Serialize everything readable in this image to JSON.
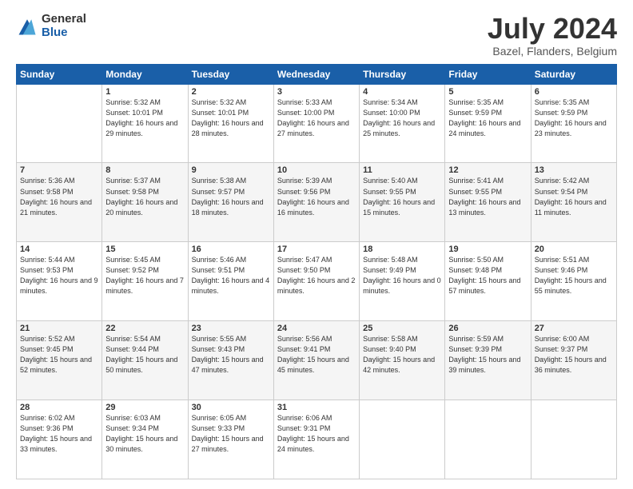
{
  "logo": {
    "general": "General",
    "blue": "Blue"
  },
  "header": {
    "month_year": "July 2024",
    "location": "Bazel, Flanders, Belgium"
  },
  "days_of_week": [
    "Sunday",
    "Monday",
    "Tuesday",
    "Wednesday",
    "Thursday",
    "Friday",
    "Saturday"
  ],
  "weeks": [
    [
      {
        "day": "",
        "sunrise": "",
        "sunset": "",
        "daylight": ""
      },
      {
        "day": "1",
        "sunrise": "Sunrise: 5:32 AM",
        "sunset": "Sunset: 10:01 PM",
        "daylight": "Daylight: 16 hours and 29 minutes."
      },
      {
        "day": "2",
        "sunrise": "Sunrise: 5:32 AM",
        "sunset": "Sunset: 10:01 PM",
        "daylight": "Daylight: 16 hours and 28 minutes."
      },
      {
        "day": "3",
        "sunrise": "Sunrise: 5:33 AM",
        "sunset": "Sunset: 10:00 PM",
        "daylight": "Daylight: 16 hours and 27 minutes."
      },
      {
        "day": "4",
        "sunrise": "Sunrise: 5:34 AM",
        "sunset": "Sunset: 10:00 PM",
        "daylight": "Daylight: 16 hours and 25 minutes."
      },
      {
        "day": "5",
        "sunrise": "Sunrise: 5:35 AM",
        "sunset": "Sunset: 9:59 PM",
        "daylight": "Daylight: 16 hours and 24 minutes."
      },
      {
        "day": "6",
        "sunrise": "Sunrise: 5:35 AM",
        "sunset": "Sunset: 9:59 PM",
        "daylight": "Daylight: 16 hours and 23 minutes."
      }
    ],
    [
      {
        "day": "7",
        "sunrise": "Sunrise: 5:36 AM",
        "sunset": "Sunset: 9:58 PM",
        "daylight": "Daylight: 16 hours and 21 minutes."
      },
      {
        "day": "8",
        "sunrise": "Sunrise: 5:37 AM",
        "sunset": "Sunset: 9:58 PM",
        "daylight": "Daylight: 16 hours and 20 minutes."
      },
      {
        "day": "9",
        "sunrise": "Sunrise: 5:38 AM",
        "sunset": "Sunset: 9:57 PM",
        "daylight": "Daylight: 16 hours and 18 minutes."
      },
      {
        "day": "10",
        "sunrise": "Sunrise: 5:39 AM",
        "sunset": "Sunset: 9:56 PM",
        "daylight": "Daylight: 16 hours and 16 minutes."
      },
      {
        "day": "11",
        "sunrise": "Sunrise: 5:40 AM",
        "sunset": "Sunset: 9:55 PM",
        "daylight": "Daylight: 16 hours and 15 minutes."
      },
      {
        "day": "12",
        "sunrise": "Sunrise: 5:41 AM",
        "sunset": "Sunset: 9:55 PM",
        "daylight": "Daylight: 16 hours and 13 minutes."
      },
      {
        "day": "13",
        "sunrise": "Sunrise: 5:42 AM",
        "sunset": "Sunset: 9:54 PM",
        "daylight": "Daylight: 16 hours and 11 minutes."
      }
    ],
    [
      {
        "day": "14",
        "sunrise": "Sunrise: 5:44 AM",
        "sunset": "Sunset: 9:53 PM",
        "daylight": "Daylight: 16 hours and 9 minutes."
      },
      {
        "day": "15",
        "sunrise": "Sunrise: 5:45 AM",
        "sunset": "Sunset: 9:52 PM",
        "daylight": "Daylight: 16 hours and 7 minutes."
      },
      {
        "day": "16",
        "sunrise": "Sunrise: 5:46 AM",
        "sunset": "Sunset: 9:51 PM",
        "daylight": "Daylight: 16 hours and 4 minutes."
      },
      {
        "day": "17",
        "sunrise": "Sunrise: 5:47 AM",
        "sunset": "Sunset: 9:50 PM",
        "daylight": "Daylight: 16 hours and 2 minutes."
      },
      {
        "day": "18",
        "sunrise": "Sunrise: 5:48 AM",
        "sunset": "Sunset: 9:49 PM",
        "daylight": "Daylight: 16 hours and 0 minutes."
      },
      {
        "day": "19",
        "sunrise": "Sunrise: 5:50 AM",
        "sunset": "Sunset: 9:48 PM",
        "daylight": "Daylight: 15 hours and 57 minutes."
      },
      {
        "day": "20",
        "sunrise": "Sunrise: 5:51 AM",
        "sunset": "Sunset: 9:46 PM",
        "daylight": "Daylight: 15 hours and 55 minutes."
      }
    ],
    [
      {
        "day": "21",
        "sunrise": "Sunrise: 5:52 AM",
        "sunset": "Sunset: 9:45 PM",
        "daylight": "Daylight: 15 hours and 52 minutes."
      },
      {
        "day": "22",
        "sunrise": "Sunrise: 5:54 AM",
        "sunset": "Sunset: 9:44 PM",
        "daylight": "Daylight: 15 hours and 50 minutes."
      },
      {
        "day": "23",
        "sunrise": "Sunrise: 5:55 AM",
        "sunset": "Sunset: 9:43 PM",
        "daylight": "Daylight: 15 hours and 47 minutes."
      },
      {
        "day": "24",
        "sunrise": "Sunrise: 5:56 AM",
        "sunset": "Sunset: 9:41 PM",
        "daylight": "Daylight: 15 hours and 45 minutes."
      },
      {
        "day": "25",
        "sunrise": "Sunrise: 5:58 AM",
        "sunset": "Sunset: 9:40 PM",
        "daylight": "Daylight: 15 hours and 42 minutes."
      },
      {
        "day": "26",
        "sunrise": "Sunrise: 5:59 AM",
        "sunset": "Sunset: 9:39 PM",
        "daylight": "Daylight: 15 hours and 39 minutes."
      },
      {
        "day": "27",
        "sunrise": "Sunrise: 6:00 AM",
        "sunset": "Sunset: 9:37 PM",
        "daylight": "Daylight: 15 hours and 36 minutes."
      }
    ],
    [
      {
        "day": "28",
        "sunrise": "Sunrise: 6:02 AM",
        "sunset": "Sunset: 9:36 PM",
        "daylight": "Daylight: 15 hours and 33 minutes."
      },
      {
        "day": "29",
        "sunrise": "Sunrise: 6:03 AM",
        "sunset": "Sunset: 9:34 PM",
        "daylight": "Daylight: 15 hours and 30 minutes."
      },
      {
        "day": "30",
        "sunrise": "Sunrise: 6:05 AM",
        "sunset": "Sunset: 9:33 PM",
        "daylight": "Daylight: 15 hours and 27 minutes."
      },
      {
        "day": "31",
        "sunrise": "Sunrise: 6:06 AM",
        "sunset": "Sunset: 9:31 PM",
        "daylight": "Daylight: 15 hours and 24 minutes."
      },
      {
        "day": "",
        "sunrise": "",
        "sunset": "",
        "daylight": ""
      },
      {
        "day": "",
        "sunrise": "",
        "sunset": "",
        "daylight": ""
      },
      {
        "day": "",
        "sunrise": "",
        "sunset": "",
        "daylight": ""
      }
    ]
  ]
}
